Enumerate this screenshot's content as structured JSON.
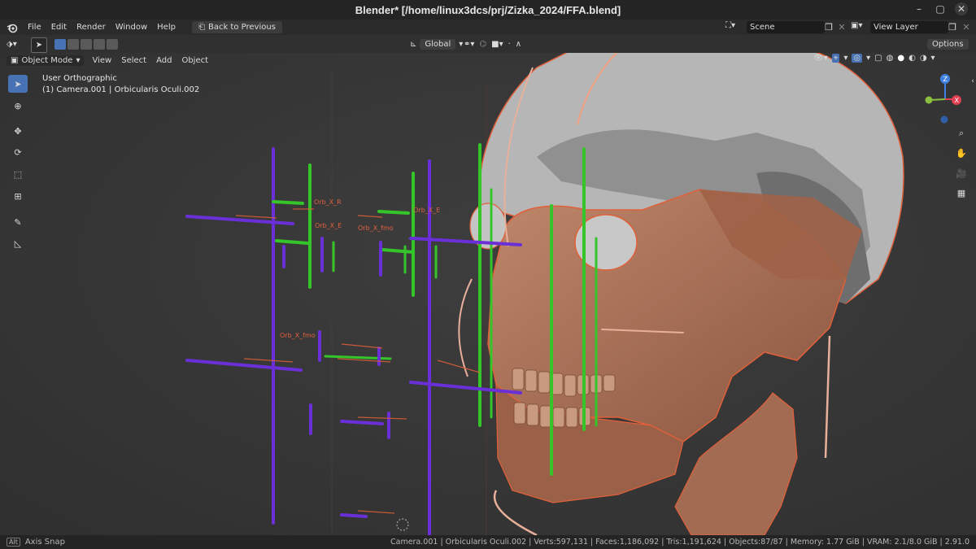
{
  "window": {
    "title": "Blender* [/home/linux3dcs/prj/Zizka_2024/FFA.blend]"
  },
  "menu": {
    "items": [
      "File",
      "Edit",
      "Render",
      "Window",
      "Help"
    ],
    "back_button": "Back to Previous"
  },
  "top_right": {
    "scene": "Scene",
    "view_layer": "View Layer"
  },
  "header": {
    "transform_orientation": "Global",
    "options": "Options"
  },
  "viewport_header": {
    "mode": "Object Mode",
    "menus": [
      "View",
      "Select",
      "Add",
      "Object"
    ]
  },
  "viewport": {
    "view_name": "User Orthographic",
    "active_info": "(1) Camera.001 | Orbicularis Oculi.002",
    "bone_labels": [
      "Orb_X_E",
      "Orb_X_fmo",
      "Orb_X_fmo",
      "Orb_X_R",
      "Orb_X_E"
    ]
  },
  "status": {
    "left_key": "Alt",
    "left": "Axis Snap",
    "right": "Camera.001 | Orbicularis Oculi.002 | Verts:597,131 | Faces:1,186,092 | Tris:1,191,624 | Objects:87/87 | Memory: 1.77 GiB | VRAM: 2.1/8.0 GiB | 2.91.0"
  },
  "colors": {
    "accent": "#4772b3",
    "bone_purple": "#6a2fd6",
    "bone_green": "#35c52a",
    "skull_grey": "#b9b9b9",
    "muscle_brown": "#a86b50"
  }
}
